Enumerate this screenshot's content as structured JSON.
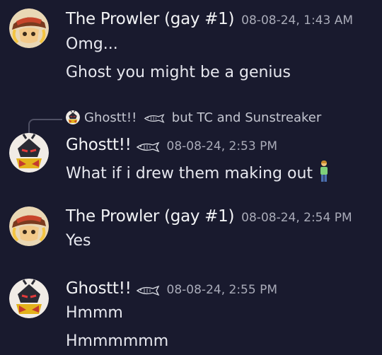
{
  "messages": [
    {
      "author": "The Prowler (gay #1)",
      "timestamp": "08-08-24, 1:43 AM",
      "lines": [
        "Omg...",
        "Ghost you might be a genius"
      ]
    },
    {
      "reply_to": {
        "author": "Ghostt!!",
        "preview": "but TC and Sunstreaker"
      },
      "author": "Ghostt!!",
      "timestamp": "08-08-24, 2:53 PM",
      "lines": [
        "What if i drew them making out"
      ]
    },
    {
      "author": "The Prowler (gay #1)",
      "timestamp": "08-08-24, 2:54 PM",
      "lines": [
        "Yes"
      ]
    },
    {
      "author": "Ghostt!!",
      "timestamp": "08-08-24, 2:55 PM",
      "lines": [
        "Hmmm",
        "Hmmmmmm"
      ]
    }
  ],
  "icons": {
    "fish": "fish-icon",
    "person_emoji": "person-standing-emoji",
    "avatar_prowler": "prowler-avatar",
    "avatar_ghost": "ghost-avatar"
  },
  "colors": {
    "background": "#191a2e",
    "author": "#f2f3f5",
    "timestamp": "#a9abb8",
    "text": "#e6e7ee"
  }
}
